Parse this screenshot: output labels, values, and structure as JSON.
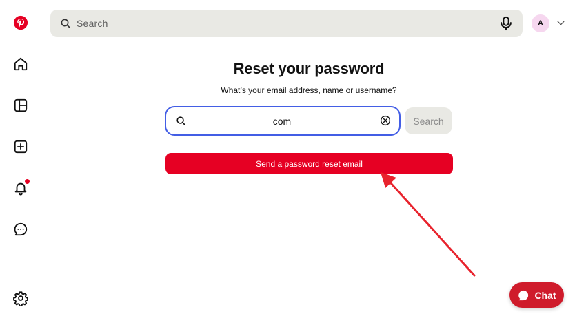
{
  "sidebar": {
    "items": [
      {
        "icon": "pinterest-logo-icon",
        "color": "#e60023"
      },
      {
        "icon": "home-icon"
      },
      {
        "icon": "boards-icon"
      },
      {
        "icon": "create-icon"
      },
      {
        "icon": "notifications-icon",
        "has_dot": true
      },
      {
        "icon": "messages-icon"
      },
      {
        "icon": "settings-icon"
      }
    ]
  },
  "header": {
    "search_placeholder": "Search",
    "avatar_initial": "A"
  },
  "main": {
    "title": "Reset your password",
    "subtitle": "What’s your email address, name or username?",
    "input_value": "com",
    "search_button_label": "Search",
    "reset_button_label": "Send a password reset email"
  },
  "chat": {
    "label": "Chat"
  },
  "colors": {
    "brand_red": "#e60023",
    "input_border": "#435ee5",
    "annotation_arrow": "#e8232d"
  }
}
